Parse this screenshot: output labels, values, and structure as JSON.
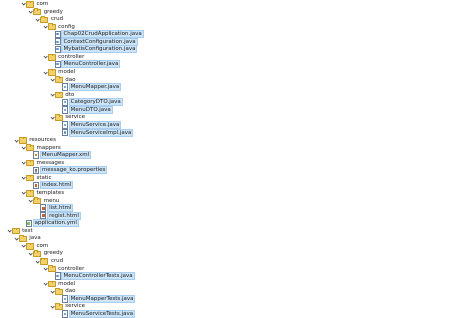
{
  "tree": [
    {
      "label": "com",
      "icon": "folder",
      "depth": 2,
      "expanded": true
    },
    {
      "label": "greedy",
      "icon": "folder",
      "depth": 3,
      "expanded": true
    },
    {
      "label": "crud",
      "icon": "folder",
      "depth": 4,
      "expanded": true
    },
    {
      "label": "config",
      "icon": "folder",
      "depth": 5,
      "expanded": true
    },
    {
      "label": "Chap02CrudApplication.java",
      "icon": "java",
      "depth": 6,
      "selected": true
    },
    {
      "label": "ContextConfiguration.java",
      "icon": "java",
      "depth": 6,
      "selected": true
    },
    {
      "label": "MybatisConfiguration.java",
      "icon": "java",
      "depth": 6,
      "selected": true
    },
    {
      "label": "controller",
      "icon": "folder",
      "depth": 5,
      "expanded": true
    },
    {
      "label": "MenuController.java",
      "icon": "java",
      "depth": 6,
      "selected": true
    },
    {
      "label": "model",
      "icon": "folder",
      "depth": 5,
      "expanded": true
    },
    {
      "label": "dao",
      "icon": "folder",
      "depth": 6,
      "expanded": true
    },
    {
      "label": "MenuMapper.java",
      "icon": "java",
      "depth": 7,
      "selected": true
    },
    {
      "label": "dto",
      "icon": "folder",
      "depth": 6,
      "expanded": true
    },
    {
      "label": "CategoryDTO.java",
      "icon": "java",
      "depth": 7,
      "selected": true
    },
    {
      "label": "MenuDTO.java",
      "icon": "java",
      "depth": 7,
      "selected": true
    },
    {
      "label": "service",
      "icon": "folder",
      "depth": 6,
      "expanded": true
    },
    {
      "label": "MenuService.java",
      "icon": "java",
      "depth": 7,
      "selected": true
    },
    {
      "label": "MenuServiceImpl.java",
      "icon": "java",
      "depth": 7,
      "selected": true
    },
    {
      "label": "resources",
      "icon": "folder",
      "depth": 1,
      "expanded": true
    },
    {
      "label": "mappers",
      "icon": "folder",
      "depth": 2,
      "expanded": true
    },
    {
      "label": "MenuMapper.xml",
      "icon": "xml",
      "depth": 3,
      "selected": true
    },
    {
      "label": "messages",
      "icon": "folder",
      "depth": 2,
      "expanded": true
    },
    {
      "label": "message_ko.properties",
      "icon": "props",
      "depth": 3,
      "selected": true
    },
    {
      "label": "static",
      "icon": "folder",
      "depth": 2,
      "expanded": true
    },
    {
      "label": "index.html",
      "icon": "html",
      "depth": 3,
      "selected": true
    },
    {
      "label": "templates",
      "icon": "folder",
      "depth": 2,
      "expanded": true
    },
    {
      "label": "menu",
      "icon": "folder",
      "depth": 3,
      "expanded": true
    },
    {
      "label": "list.html",
      "icon": "html",
      "depth": 4,
      "selected": true
    },
    {
      "label": "regist.html",
      "icon": "html",
      "depth": 4,
      "selected": true
    },
    {
      "label": "application.yml",
      "icon": "yml",
      "depth": 2,
      "selected": true
    },
    {
      "label": "test",
      "icon": "folder",
      "depth": 0,
      "expanded": true
    },
    {
      "label": "java",
      "icon": "folder",
      "depth": 1,
      "expanded": true
    },
    {
      "label": "com",
      "icon": "folder",
      "depth": 2,
      "expanded": true
    },
    {
      "label": "greedy",
      "icon": "folder",
      "depth": 3,
      "expanded": true
    },
    {
      "label": "crud",
      "icon": "folder",
      "depth": 4,
      "expanded": true
    },
    {
      "label": "controller",
      "icon": "folder",
      "depth": 5,
      "expanded": true
    },
    {
      "label": "MenuControllerTests.java",
      "icon": "java",
      "depth": 6,
      "selected": true
    },
    {
      "label": "model",
      "icon": "folder",
      "depth": 5,
      "expanded": true
    },
    {
      "label": "dao",
      "icon": "folder",
      "depth": 6,
      "expanded": true
    },
    {
      "label": "MenuMapperTests.java",
      "icon": "java",
      "depth": 7,
      "selected": true
    },
    {
      "label": "service",
      "icon": "folder",
      "depth": 6,
      "expanded": true
    },
    {
      "label": "MenuServiceTests.java",
      "icon": "java",
      "depth": 7,
      "selected": true
    }
  ]
}
